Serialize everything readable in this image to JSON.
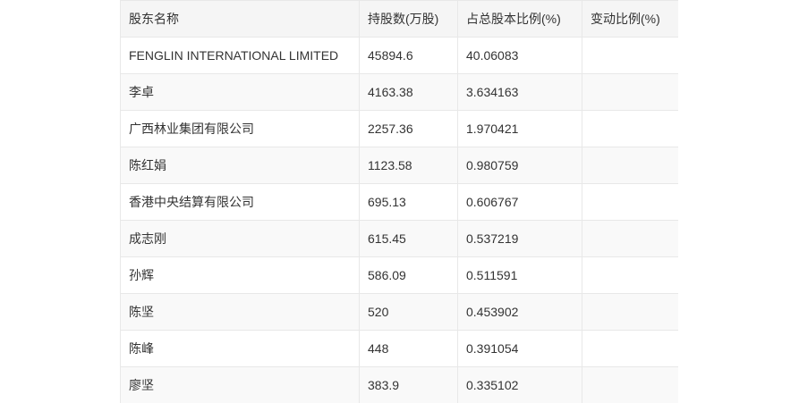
{
  "table": {
    "headers": [
      "股东名称",
      "持股数(万股)",
      "占总股本比例(%)",
      "变动比例(%)"
    ],
    "rows": [
      [
        "FENGLIN INTERNATIONAL LIMITED",
        "45894.6",
        "40.06083",
        ""
      ],
      [
        "李卓",
        "4163.38",
        "3.634163",
        ""
      ],
      [
        "广西林业集团有限公司",
        "2257.36",
        "1.970421",
        ""
      ],
      [
        "陈红娟",
        "1123.58",
        "0.980759",
        ""
      ],
      [
        "香港中央结算有限公司",
        "695.13",
        "0.606767",
        ""
      ],
      [
        "成志刚",
        "615.45",
        "0.537219",
        ""
      ],
      [
        "孙辉",
        "586.09",
        "0.511591",
        ""
      ],
      [
        "陈坚",
        "520",
        "0.453902",
        ""
      ],
      [
        "陈峰",
        "448",
        "0.391054",
        ""
      ],
      [
        "廖坚",
        "383.9",
        "0.335102",
        ""
      ]
    ]
  }
}
